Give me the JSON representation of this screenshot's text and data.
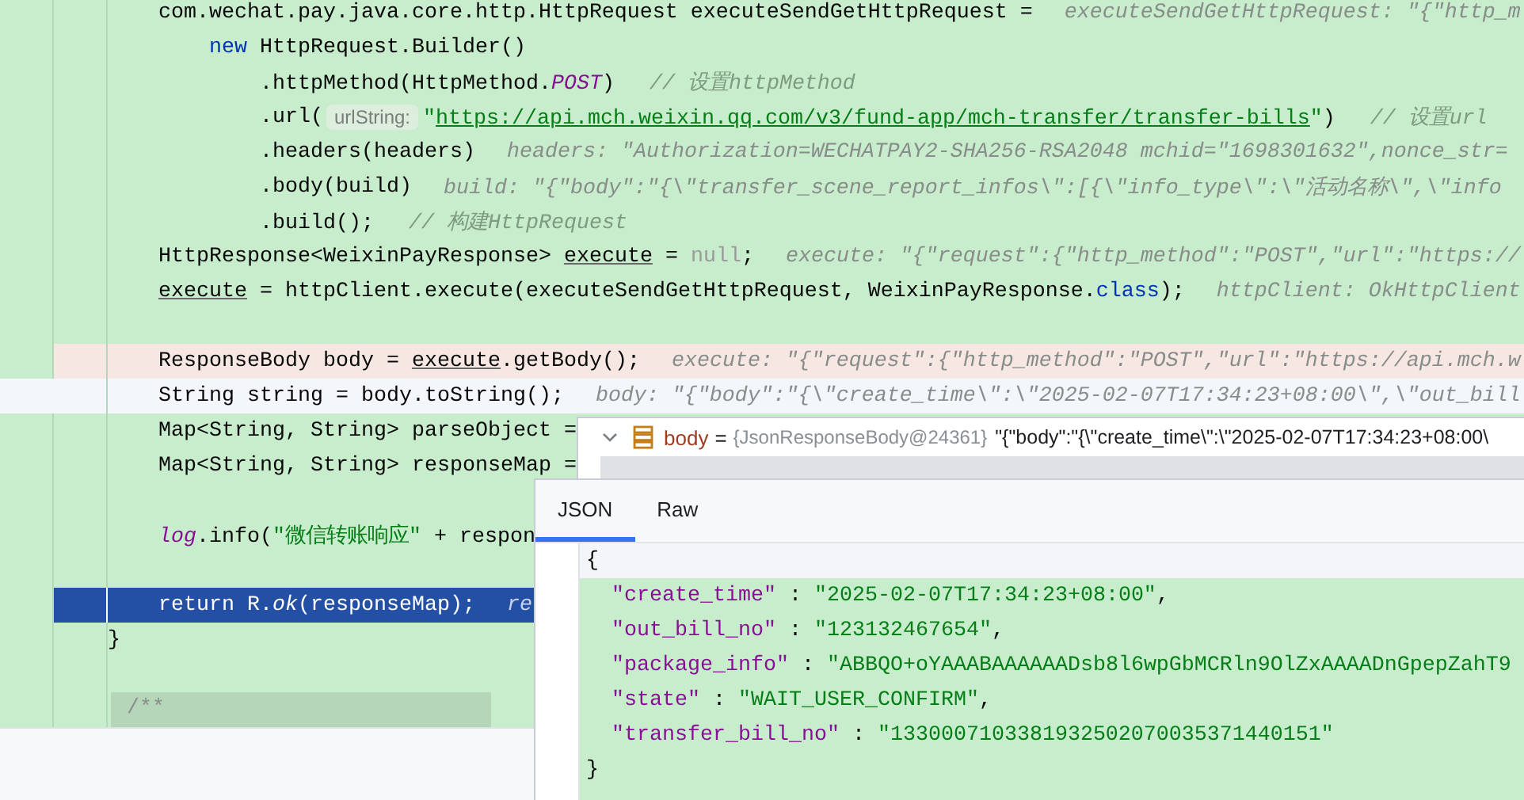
{
  "editor": {
    "lines": [
      {
        "kind": "code",
        "tokens": [
          {
            "kind": "plain",
            "text": "    com.wechat.pay.java.core.http.HttpRequest executeSendGetHttpRequest ="
          },
          {
            "kind": "hint",
            "text": "executeSendGetHttpRequest: \"{\"http_m"
          }
        ]
      },
      {
        "kind": "code",
        "tokens": [
          {
            "kind": "keyword",
            "text": "        new"
          },
          {
            "kind": "plain",
            "text": " HttpRequest.Builder()"
          }
        ]
      },
      {
        "kind": "code",
        "tokens": [
          {
            "kind": "plain",
            "text": "            .httpMethod(HttpMethod."
          },
          {
            "kind": "static",
            "text": "POST"
          },
          {
            "kind": "plain",
            "text": ")"
          },
          {
            "kind": "comment",
            "text": "// 设置httpMethod"
          }
        ]
      },
      {
        "kind": "code",
        "tokens": [
          {
            "kind": "plain",
            "text": "            .url("
          },
          {
            "kind": "param",
            "text": "urlString:"
          },
          {
            "kind": "string",
            "text": "\""
          },
          {
            "kind": "link",
            "text": "https://api.mch.weixin.qq.com/v3/fund-app/mch-transfer/transfer-bills"
          },
          {
            "kind": "string",
            "text": "\""
          },
          {
            "kind": "plain",
            "text": ")"
          },
          {
            "kind": "comment",
            "text": "// 设置url"
          }
        ]
      },
      {
        "kind": "code",
        "tokens": [
          {
            "kind": "plain",
            "text": "            .headers(headers)"
          },
          {
            "kind": "hint",
            "text": "headers: \"Authorization=WECHATPAY2-SHA256-RSA2048 mchid=\"1698301632\",nonce_str="
          }
        ]
      },
      {
        "kind": "code",
        "tokens": [
          {
            "kind": "plain",
            "text": "            .body(build)"
          },
          {
            "kind": "hint",
            "text": "build: \"{\"body\":\"{\\\"transfer_scene_report_infos\\\":[{\\\"info_type\\\":\\\"活动名称\\\",\\\"info"
          }
        ]
      },
      {
        "kind": "code",
        "tokens": [
          {
            "kind": "plain",
            "text": "            .build();"
          },
          {
            "kind": "comment",
            "text": "// 构建HttpRequest"
          }
        ]
      },
      {
        "kind": "code",
        "tokens": [
          {
            "kind": "plain",
            "text": "    HttpResponse<WeixinPayResponse> "
          },
          {
            "kind": "ref",
            "text": "execute"
          },
          {
            "kind": "plain",
            "text": " = "
          },
          {
            "kind": "null",
            "text": "null"
          },
          {
            "kind": "plain",
            "text": ";"
          },
          {
            "kind": "hint",
            "text": "execute: \"{\"request\":{\"http_method\":\"POST\",\"url\":\"https://"
          }
        ]
      },
      {
        "kind": "code",
        "tokens": [
          {
            "kind": "ref",
            "text": "    execute"
          },
          {
            "kind": "plain",
            "text": " = httpClient.execute(executeSendGetHttpRequest, WeixinPayResponse."
          },
          {
            "kind": "keyword",
            "text": "class"
          },
          {
            "kind": "plain",
            "text": ");"
          },
          {
            "kind": "hint",
            "text": "httpClient: OkHttpClient"
          }
        ]
      },
      {
        "kind": "blank"
      },
      {
        "kind": "marked",
        "tokens": [
          {
            "kind": "plain",
            "text": "    ResponseBody body = "
          },
          {
            "kind": "ref",
            "text": "execute"
          },
          {
            "kind": "plain",
            "text": ".getBody();"
          },
          {
            "kind": "hint",
            "text": "execute: \"{\"request\":{\"http_method\":\"POST\",\"url\":\"https://api.mch.w"
          }
        ]
      },
      {
        "kind": "caret",
        "tokens": [
          {
            "kind": "plain",
            "text": "    String string = body.toString();"
          },
          {
            "kind": "hint",
            "text": "body: \"{\"body\":\"{\\\"create_time\\\":\\\"2025-02-07T17:34:23+08:00\\\",\\\"out_bill"
          }
        ]
      },
      {
        "kind": "code",
        "tokens": [
          {
            "kind": "plain",
            "text": "    Map<String, String> parseObject ="
          }
        ]
      },
      {
        "kind": "code",
        "tokens": [
          {
            "kind": "plain",
            "text": "    Map<String, String> responseMap ="
          }
        ]
      },
      {
        "kind": "blank"
      },
      {
        "kind": "code",
        "tokens": [
          {
            "kind": "static",
            "text": "    log"
          },
          {
            "kind": "plain",
            "text": ".info("
          },
          {
            "kind": "string",
            "text": "\"微信转账响应\""
          },
          {
            "kind": "plain",
            "text": " + respon"
          }
        ]
      },
      {
        "kind": "blank"
      },
      {
        "kind": "execution",
        "tokens": [
          {
            "kind": "plain",
            "text": "    return R."
          },
          {
            "kind": "italic",
            "text": "ok"
          },
          {
            "kind": "plain",
            "text": "(responseMap);"
          },
          {
            "kind": "hint",
            "text": "re"
          }
        ]
      },
      {
        "kind": "code",
        "tokens": [
          {
            "kind": "plain",
            "text": "}"
          }
        ]
      },
      {
        "kind": "blank"
      },
      {
        "kind": "folded",
        "tokens": [
          {
            "kind": "comment",
            "text": "/**"
          }
        ]
      }
    ]
  },
  "value_popup": {
    "expanded": true,
    "name": "body",
    "equals": "=",
    "type_text": "{JsonResponseBody@24361}",
    "value": "\"{\"body\":\"{\\\"create_time\\\":\\\"2025-02-07T17:34:23+08:00\\"
  },
  "json_viewer": {
    "tabs": [
      {
        "label": "JSON",
        "selected": true
      },
      {
        "label": "Raw",
        "selected": false
      }
    ],
    "lines": [
      {
        "current": true,
        "tokens": [
          {
            "kind": "punct",
            "text": "{"
          }
        ]
      },
      {
        "current": false,
        "tokens": [
          {
            "kind": "key",
            "text": "  \"create_time\""
          },
          {
            "kind": "punct",
            "text": " : "
          },
          {
            "kind": "string",
            "text": "\"2025-02-07T17:34:23+08:00\""
          },
          {
            "kind": "punct",
            "text": ","
          }
        ]
      },
      {
        "current": false,
        "tokens": [
          {
            "kind": "key",
            "text": "  \"out_bill_no\""
          },
          {
            "kind": "punct",
            "text": " : "
          },
          {
            "kind": "string",
            "text": "\"123132467654\""
          },
          {
            "kind": "punct",
            "text": ","
          }
        ]
      },
      {
        "current": false,
        "tokens": [
          {
            "kind": "key",
            "text": "  \"package_info\""
          },
          {
            "kind": "punct",
            "text": " : "
          },
          {
            "kind": "string",
            "text": "\"ABBQO+oYAAABAAAAAADsb8l6wpGbMCRln9OlZxAAAADnGpepZahT9"
          }
        ]
      },
      {
        "current": false,
        "tokens": [
          {
            "kind": "key",
            "text": "  \"state\""
          },
          {
            "kind": "punct",
            "text": " : "
          },
          {
            "kind": "string",
            "text": "\"WAIT_USER_CONFIRM\""
          },
          {
            "kind": "punct",
            "text": ","
          }
        ]
      },
      {
        "current": false,
        "tokens": [
          {
            "kind": "key",
            "text": "  \"transfer_bill_no\""
          },
          {
            "kind": "punct",
            "text": " : "
          },
          {
            "kind": "string",
            "text": "\"1330007103381932502070035371440151\""
          }
        ]
      },
      {
        "current": false,
        "tokens": [
          {
            "kind": "punct",
            "text": "}"
          }
        ]
      }
    ]
  }
}
